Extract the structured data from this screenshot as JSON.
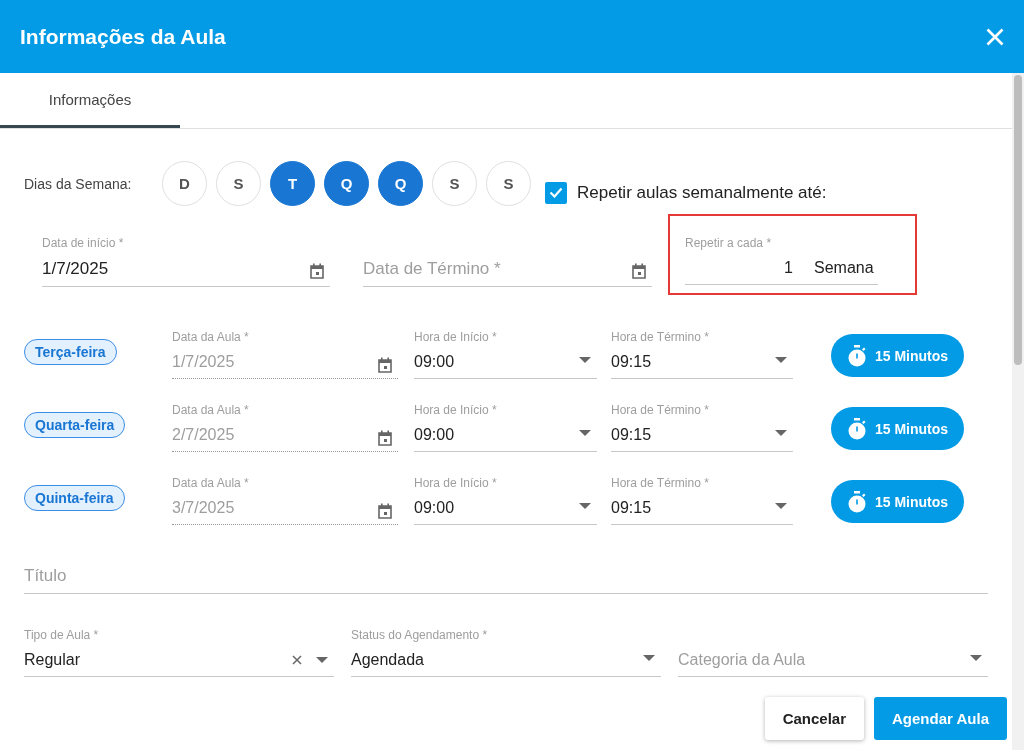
{
  "dialog": {
    "title": "Informações da Aula"
  },
  "tabs": [
    {
      "label": "Informações",
      "selected": true
    }
  ],
  "weekdays": {
    "label": "Dias da Semana:",
    "days": [
      {
        "letter": "D",
        "selected": false
      },
      {
        "letter": "S",
        "selected": false
      },
      {
        "letter": "T",
        "selected": true
      },
      {
        "letter": "Q",
        "selected": true
      },
      {
        "letter": "Q",
        "selected": true
      },
      {
        "letter": "S",
        "selected": false
      },
      {
        "letter": "S",
        "selected": false
      }
    ]
  },
  "repeat": {
    "label": "Repetir aulas semanalmente até:",
    "checked": true
  },
  "start_date": {
    "label": "Data de início *",
    "value": "1/7/2025"
  },
  "end_date": {
    "placeholder": "Data de Término *"
  },
  "repeat_every": {
    "label": "Repetir a cada *",
    "value": "1",
    "unit": "Semana",
    "highlighted": true
  },
  "sessions": [
    {
      "day": "Terça-feira",
      "date_label": "Data da Aula *",
      "date": "1/7/2025",
      "date_disabled": true,
      "start_label": "Hora de Início *",
      "start": "09:00",
      "end_label": "Hora de Término *",
      "end": "09:15",
      "duration": "15 Minutos"
    },
    {
      "day": "Quarta-feira",
      "date_label": "Data da Aula *",
      "date": "2/7/2025",
      "date_disabled": true,
      "start_label": "Hora de Início *",
      "start": "09:00",
      "end_label": "Hora de Término *",
      "end": "09:15",
      "duration": "15 Minutos"
    },
    {
      "day": "Quinta-feira",
      "date_label": "Data da Aula *",
      "date": "3/7/2025",
      "date_disabled": true,
      "start_label": "Hora de Início *",
      "start": "09:00",
      "end_label": "Hora de Término *",
      "end": "09:15",
      "duration": "15 Minutos"
    }
  ],
  "title_field": {
    "placeholder": "Título"
  },
  "class_type": {
    "label": "Tipo de Aula *",
    "value": "Regular"
  },
  "status": {
    "label": "Status do Agendamento *",
    "value": "Agendada"
  },
  "category": {
    "placeholder": "Categoria da Aula"
  },
  "buttons": [
    {
      "label": "Cancelar",
      "kind": "secondary"
    },
    {
      "label": "Agendar Aula",
      "kind": "primary"
    }
  ]
}
